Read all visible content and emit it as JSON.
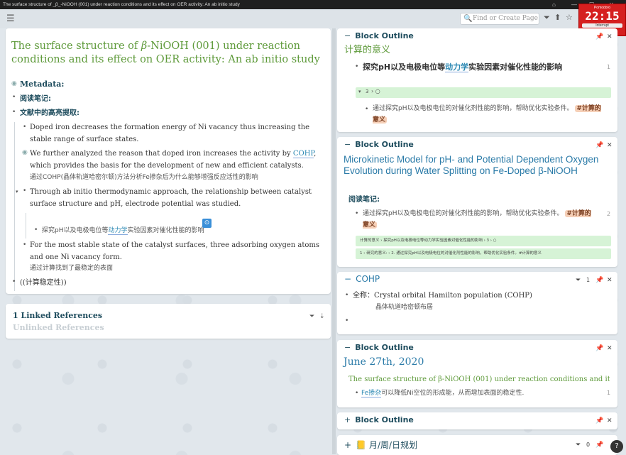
{
  "window": {
    "title": "The surface structure of _β_-NiOOH (001) under reaction conditions and its effect on OER activity: An ab initio study",
    "controls": [
      "⌂",
      "—",
      "☐",
      "✕"
    ]
  },
  "search": {
    "placeholder": "Find or Create Page"
  },
  "topbar_icons": [
    "🔍",
    "⏷",
    "⬆",
    "☆",
    "⋯"
  ],
  "pomodoro": {
    "label": "Pomodoro",
    "time": "22:15",
    "button": "Interrupt",
    "color": "#d51f1f"
  },
  "page": {
    "title_pre": "The surface structure of ",
    "title_beta": "β",
    "title_post": "-NiOOH (001) under reaction conditions and its effect on OER activity: An ab initio study",
    "metadata": "Metadata:",
    "reading_notes": "阅读笔记:",
    "highlights": "文献中的高亮提取:",
    "b1": "Doped iron decreases the formation energy of Ni vacancy thus increasing the stable range of surface states.",
    "b2_pre": "We further analyzed the reason that doped iron increases the activity by ",
    "b2_link": "COHP",
    "b2_post": ", which provides the basis for the development of new and efficient catalysts.",
    "b2_note": "通过COHP(晶体轨道哈密尔顿)方法分析Fe掺杂后为什么能够增强反应活性的影响",
    "b3": "Through ab initio thermodynamic approach, the relationship between catalyst surface structure and pH, electrode potential was studied.",
    "b3_child_pre": "探究pH以及电极电位等",
    "b3_child_link": "动力学",
    "b3_child_post": "实验因素对催化性能的影响",
    "b4": "For the most stable state of the catalyst surfaces, three adsorbing oxygen atoms and one Ni vacancy form.",
    "b4_note": "通过计算找到了最稳定的表面",
    "b5": "((计算稳定性))",
    "accent": "#5e9a3a"
  },
  "refs": {
    "linked": "1 Linked References",
    "unlinked": "Unlinked References"
  },
  "sidebar": [
    {
      "header": "Block Outline",
      "count": "1",
      "title": "计算的意义",
      "bullet_pre": "探究pH以及电极电位等",
      "bullet_link": "动力学",
      "bullet_post": "实验因素对催化性能的影响",
      "collapsed": "3",
      "note": "通过探究pH以及电极电位的对催化剂性能的影响，帮助优化实验条件。",
      "tag": "#计算的意义"
    },
    {
      "header": "Block Outline",
      "count": "2",
      "title": "Microkinetic Model for pH- and Potential Dependent Oxygen Evolution during Water Splitting on Fe-Doped β-NiOOH",
      "label": "阅读笔记:",
      "note": "通过探究pH以及电极电位的对催化剂性能的影响，帮助优化实验条件。",
      "tag": "#计算的意义",
      "row1": "计算的意义 › 探究pH以及电极电位等动力学实验因素对催化性能的影响 › 3 › ○",
      "row2": "1 › 研究的意义: › 2. 通过探究pH以及电极电位的对催化剂性能的影响，帮助优化实验条件。#计算的意义"
    },
    {
      "header": "COHP",
      "count": "1",
      "line1": "全称：Crystal orbital Hamilton population (COHP)",
      "line2": "晶体轨道哈密顿布居"
    },
    {
      "header": "Block Outline",
      "count": "1",
      "title": "June 27th, 2020",
      "link": "The surface structure of β-NiOOH (001) under reaction conditions and its e",
      "bullet_link": "Fe掺杂",
      "bullet_post": "可以降低Ni空位的形成能，从而增加表面的稳定性."
    },
    {
      "header": "Block Outline"
    },
    {
      "header": "月/周/日规划",
      "count": "0",
      "icon": "📒"
    }
  ],
  "help": "?"
}
